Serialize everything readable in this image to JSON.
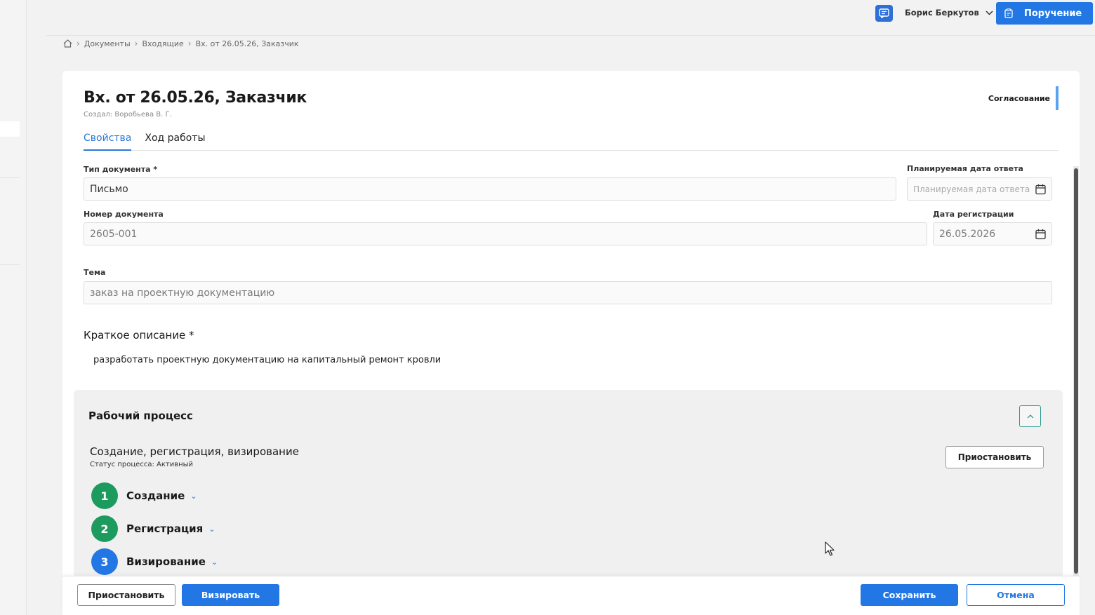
{
  "topbar": {
    "user_name": "Борис Беркутов",
    "assign_button": "Поручение"
  },
  "breadcrumb": [
    "Документы",
    "Входящие",
    "Вх. от 26.05.26, Заказчик"
  ],
  "document": {
    "title": "Вх. от 26.05.26, Заказчик",
    "author": "Создал: Воробьева В. Г.",
    "status": "Согласование",
    "tabs": [
      "Свойства",
      "Ход работы"
    ]
  },
  "form": {
    "doc_type_label": "Тип документа *",
    "doc_type_value": "Письмо",
    "planned_date_label": "Планируемая дата ответа",
    "planned_date_placeholder": "Планируемая дата ответа",
    "doc_number_label": "Номер документа",
    "doc_number_value": "2605-001",
    "reg_date_label": "Дата регистрации",
    "reg_date_value": "26.05.2026",
    "subject_label": "Тема",
    "subject_value": "заказ на проектную документацию",
    "short_desc_label": "Краткое описание *",
    "short_desc_value": "разработать проектную документацию на капитальный ремонт кровли"
  },
  "workflow": {
    "title": "Рабочий процесс",
    "process_name": "Создание, регистрация, визирование",
    "process_status": "Статус процесса: Активный",
    "pause_button": "Приостановить",
    "stages": [
      {
        "num": "1",
        "name": "Создание",
        "state": "done"
      },
      {
        "num": "2",
        "name": "Регистрация",
        "state": "done"
      },
      {
        "num": "3",
        "name": "Визирование",
        "state": "current"
      }
    ]
  },
  "footer": {
    "pause": "Приостановить",
    "approve": "Визировать",
    "save": "Сохранить",
    "cancel": "Отмена"
  },
  "colors": {
    "primary": "#2377e4",
    "stage_done": "#1d9b5f",
    "stage_current": "#2377e4",
    "status_accent": "#5aa3ee"
  }
}
